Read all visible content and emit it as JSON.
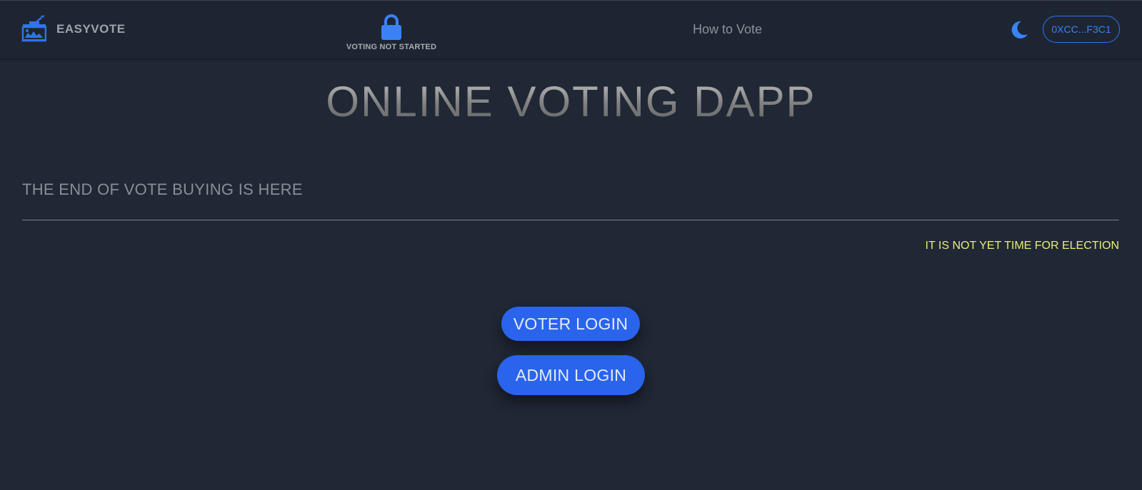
{
  "navbar": {
    "brand": {
      "icon": "ballot-box-icon",
      "name": "EASYVOTE"
    },
    "status": {
      "icon": "lock-icon",
      "label": "VOTING NOT STARTED"
    },
    "how_to_vote": "How to Vote",
    "theme_toggle_icon": "moon-icon",
    "wallet_address": "0XCC...F3C1"
  },
  "main": {
    "title": "ONLINE VOTING DAPP",
    "subtitle": "THE END OF VOTE BUYING IS HERE",
    "notice": "IT IS NOT YET TIME FOR ELECTION",
    "voter_login_label": "VOTER LOGIN",
    "admin_login_label": "ADMIN LOGIN"
  },
  "colors": {
    "background": "#202735",
    "accent": "#2a64ec",
    "notice": "#e8ec7a"
  }
}
